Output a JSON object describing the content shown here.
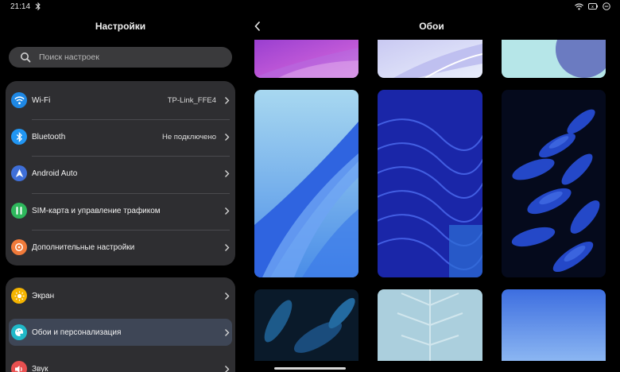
{
  "status_bar": {
    "time": "21:14"
  },
  "settings": {
    "title": "Настройки",
    "search_placeholder": "Поиск настроек",
    "group1": [
      {
        "label": "Wi-Fi",
        "value": "TP-Link_FFE4",
        "icon": "wifi-icon",
        "color": "#1e88e5"
      },
      {
        "label": "Bluetooth",
        "value": "Не подключено",
        "icon": "bluetooth-icon",
        "color": "#2196f3"
      },
      {
        "label": "Android Auto",
        "value": "",
        "icon": "android-auto-icon",
        "color": "#3f6fd8"
      },
      {
        "label": "SIM-карта и управление трафиком",
        "value": "",
        "icon": "sim-card-icon",
        "color": "#2eb85c"
      },
      {
        "label": "Дополнительные настройки",
        "value": "",
        "icon": "more-settings-icon",
        "color": "#f07a3a"
      }
    ],
    "group2": [
      {
        "label": "Экран",
        "value": "",
        "icon": "display-icon",
        "color": "#f5b400"
      },
      {
        "label": "Обои и персонализация",
        "value": "",
        "icon": "wallpaper-icon",
        "color": "#20b8c8"
      },
      {
        "label": "Звук",
        "value": "",
        "icon": "sound-icon",
        "color": "#e85050"
      }
    ]
  },
  "wallpapers": {
    "title": "Обои",
    "items": [
      "wallpaper-1",
      "wallpaper-2",
      "wallpaper-3",
      "wallpaper-4",
      "wallpaper-5",
      "wallpaper-6",
      "wallpaper-7",
      "wallpaper-8",
      "wallpaper-9"
    ]
  }
}
